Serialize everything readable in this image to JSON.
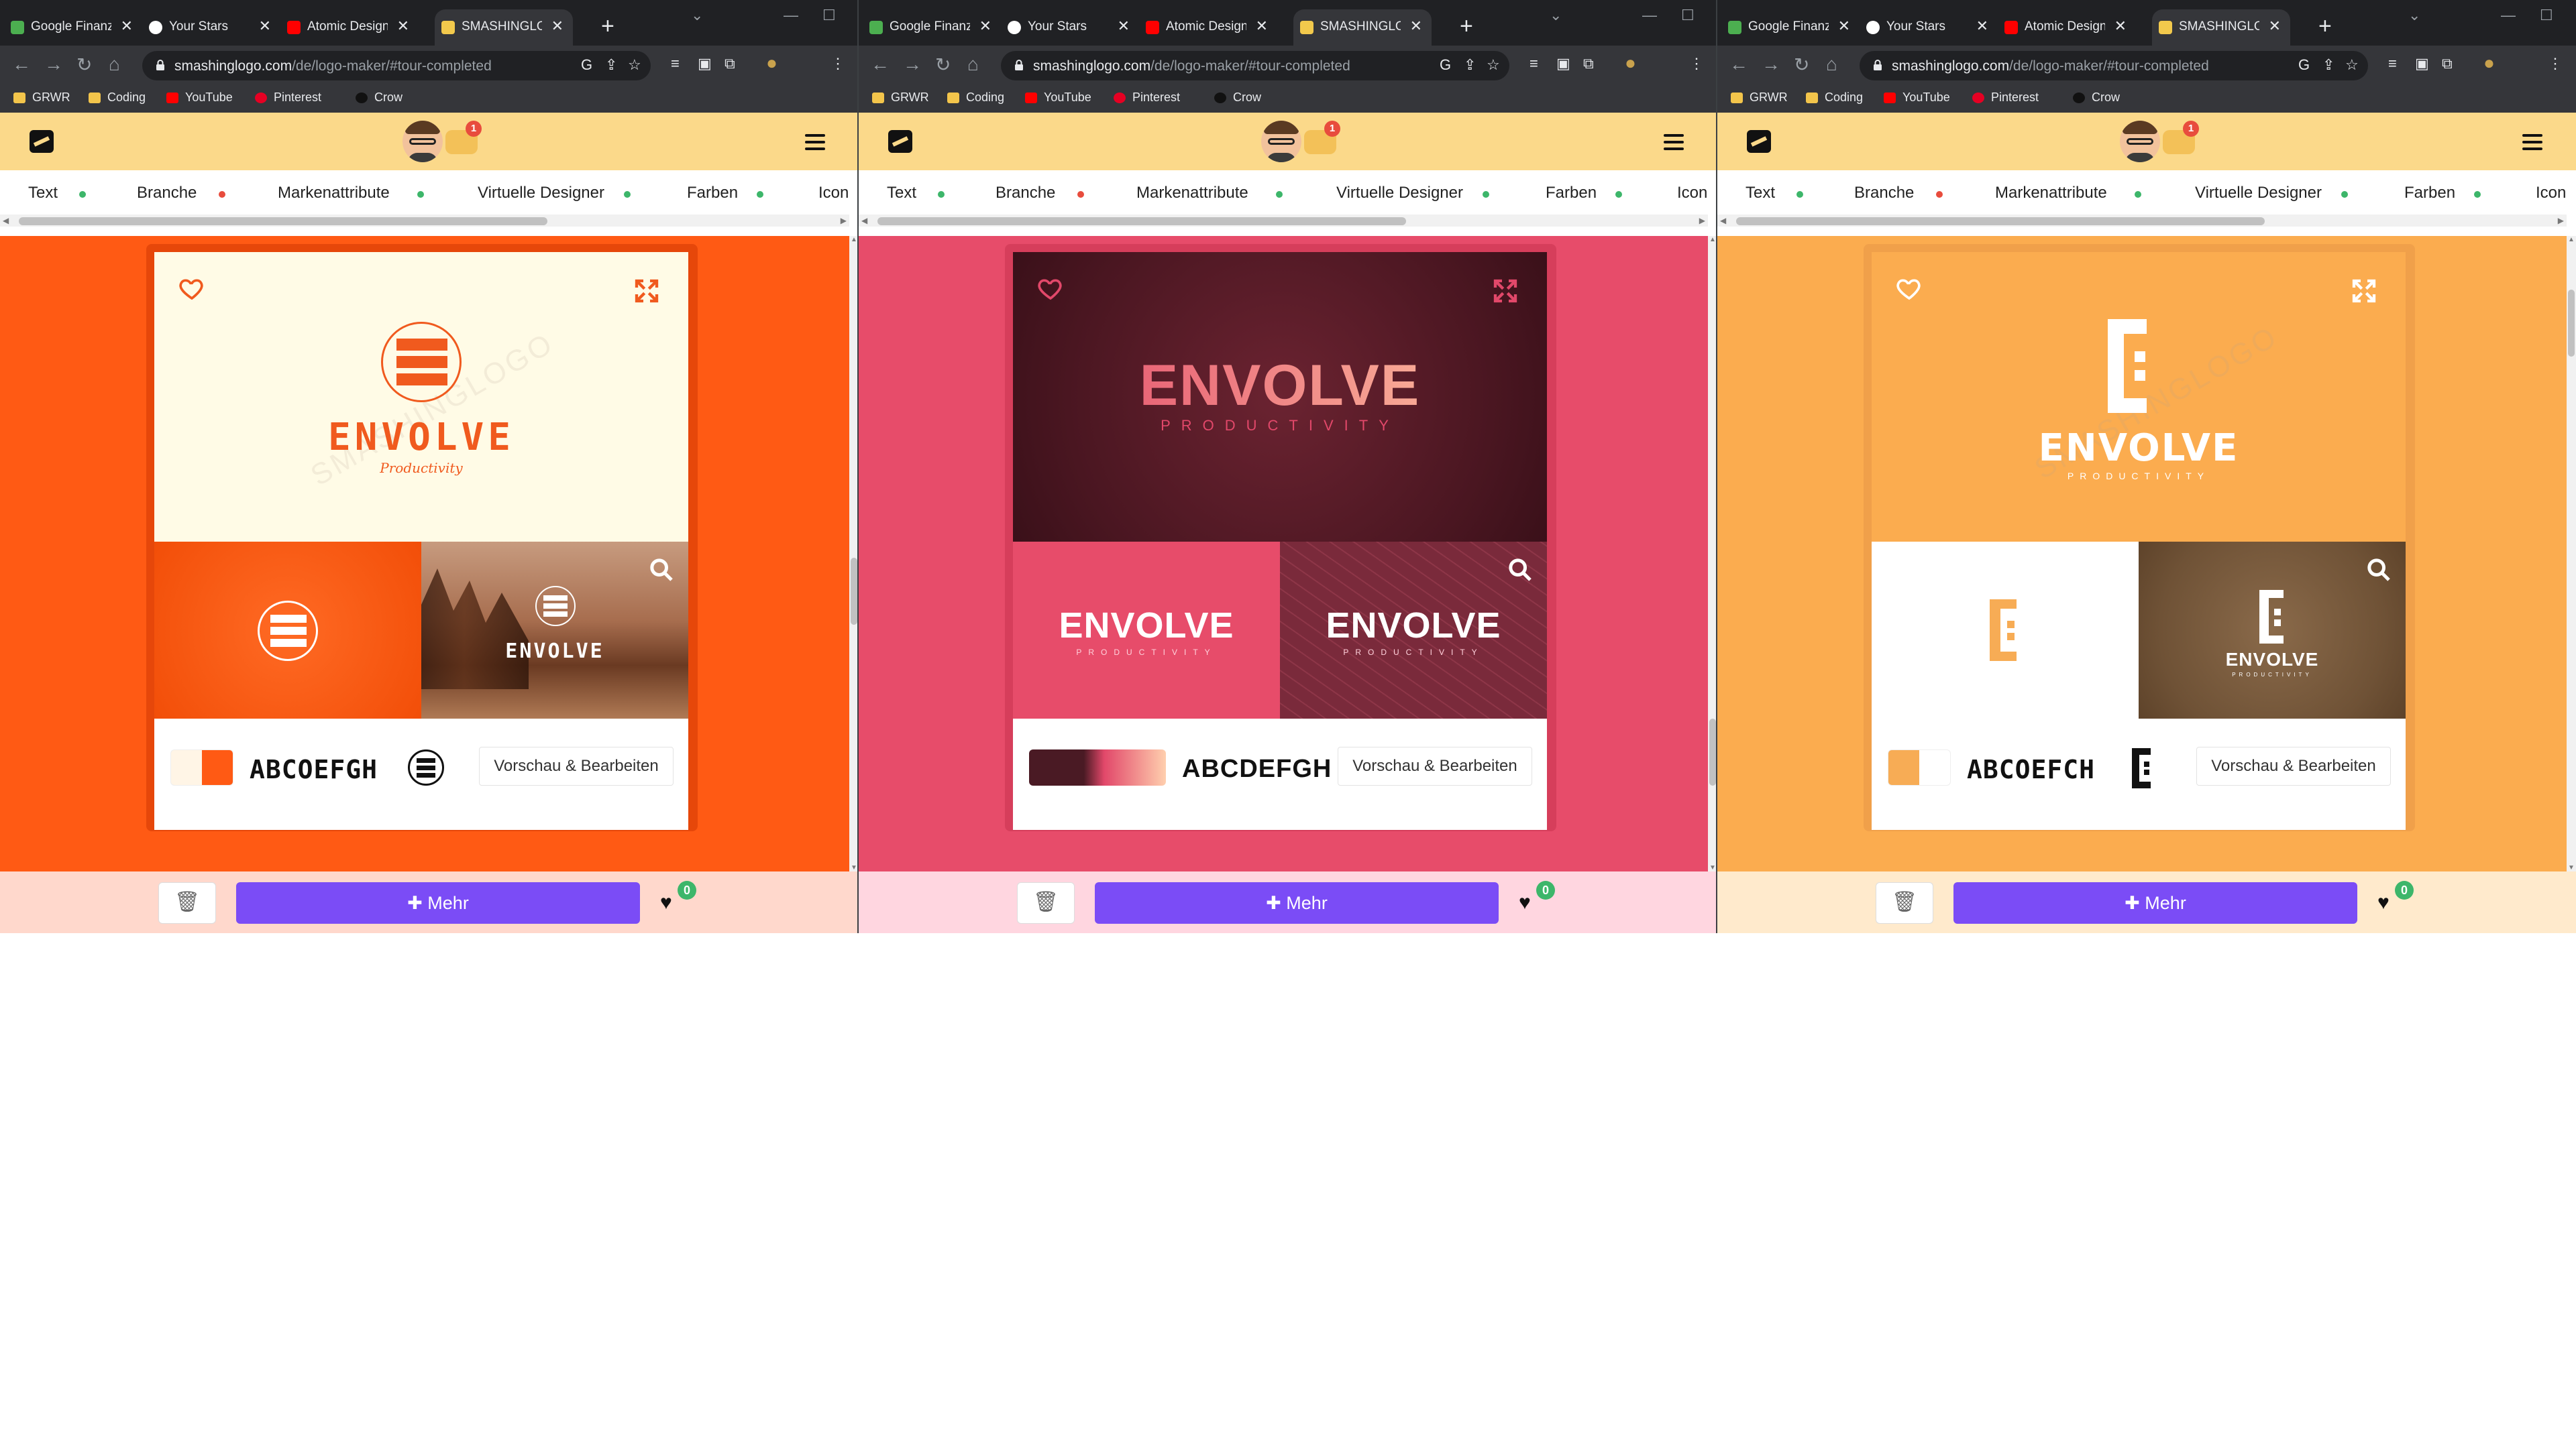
{
  "browser": {
    "tabs": [
      {
        "label": "Google Finanzen",
        "icon": "google-finance-icon"
      },
      {
        "label": "Your Stars",
        "icon": "github-icon"
      },
      {
        "label": "Atomic Design",
        "icon": "youtube-icon"
      },
      {
        "label": "SMASHINGLOGO",
        "icon": "smashinglogo-icon"
      }
    ],
    "new_tab": "+",
    "url_host": "smashinglogo.com",
    "url_path": "/de/logo-maker/#tour-completed",
    "bookmarks": [
      {
        "label": "GRWR",
        "icon": "folder-icon"
      },
      {
        "label": "Coding",
        "icon": "folder-icon"
      },
      {
        "label": "YouTube",
        "icon": "youtube-icon"
      },
      {
        "label": "Pinterest",
        "icon": "pinterest-icon"
      },
      {
        "label": "Crow",
        "icon": "crow-icon"
      }
    ]
  },
  "site": {
    "chat_badge": "1",
    "filters": [
      {
        "label": "Text",
        "dot": "#3db66a"
      },
      {
        "label": "Branche",
        "dot": "#e84c3d"
      },
      {
        "label": "Markenattribute",
        "dot": "#3db66a"
      },
      {
        "label": "Virtuelle Designer",
        "dot": "#3db66a"
      },
      {
        "label": "Farben",
        "dot": "#3db66a"
      },
      {
        "label": "Icon",
        "dot": ""
      }
    ],
    "preview_button": "Vorschau & Bearbeiten",
    "more_button": "Mehr",
    "favorites_count": "0"
  },
  "windows": [
    {
      "theme": "orange",
      "bg": "#ff5a14",
      "bottom_bg": "#ffd8cc",
      "logo_name": "ENVOLVE",
      "tagline": "Productivity",
      "watermark": "SMASHINGLOGO",
      "font_sample": "ABCOEFGH",
      "swatches": [
        "#fff5e6",
        "#ff5a14"
      ]
    },
    {
      "theme": "pink",
      "bg": "#e74c6a",
      "bottom_bg": "#ffd6e0",
      "logo_name": "ENVOLVE",
      "tagline": "PRODUCTIVITY",
      "watermark": "",
      "font_sample": "ABCDEFGH",
      "swatches": [
        "#4a1a24",
        "#ffcfae"
      ]
    },
    {
      "theme": "amber",
      "bg": "#fbac4f",
      "bottom_bg": "#ffeacc",
      "logo_name": "ENVOLVE",
      "tagline": "PRODUCTIVITY",
      "watermark": "SMASHINGLOGO",
      "font_sample": "ABCOEFCH",
      "swatches": [
        "#f7ac55",
        "#ffffff"
      ]
    }
  ]
}
